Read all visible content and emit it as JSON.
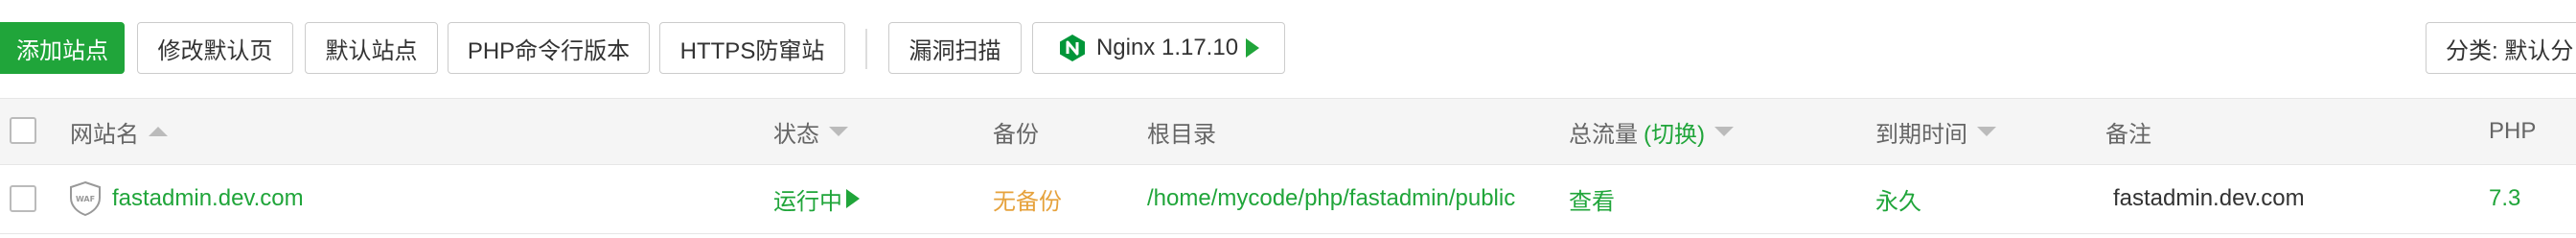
{
  "toolbar": {
    "add_site": "添加站点",
    "edit_default_page": "修改默认页",
    "default_site": "默认站点",
    "php_cli_version": "PHP命令行版本",
    "https_proxy": "HTTPS防窜站",
    "vuln_scan": "漏洞扫描",
    "nginx_version": "Nginx 1.17.10",
    "category": "分类: 默认分"
  },
  "table": {
    "columns": {
      "site_name": "网站名",
      "status": "状态",
      "backup": "备份",
      "root_dir": "根目录",
      "traffic": "总流量",
      "traffic_switch": "(切换)",
      "expire": "到期时间",
      "remark": "备注",
      "php": "PHP"
    },
    "rows": [
      {
        "site_name": "fastadmin.dev.com",
        "status": "运行中",
        "backup": "无备份",
        "root_dir": "/home/mycode/php/fastadmin/public",
        "traffic": "查看",
        "expire": "永久",
        "remark": "fastadmin.dev.com",
        "php": "7.3"
      }
    ]
  },
  "colors": {
    "accent": "#20a53a",
    "warning": "#e6a23c",
    "header_bg": "#f5f5f5"
  },
  "icons": {
    "nginx": "nginx-logo-icon",
    "waf": "waf-shield-icon",
    "sort_asc": "sort-up-icon",
    "sort_desc": "sort-down-icon",
    "play": "play-icon"
  }
}
